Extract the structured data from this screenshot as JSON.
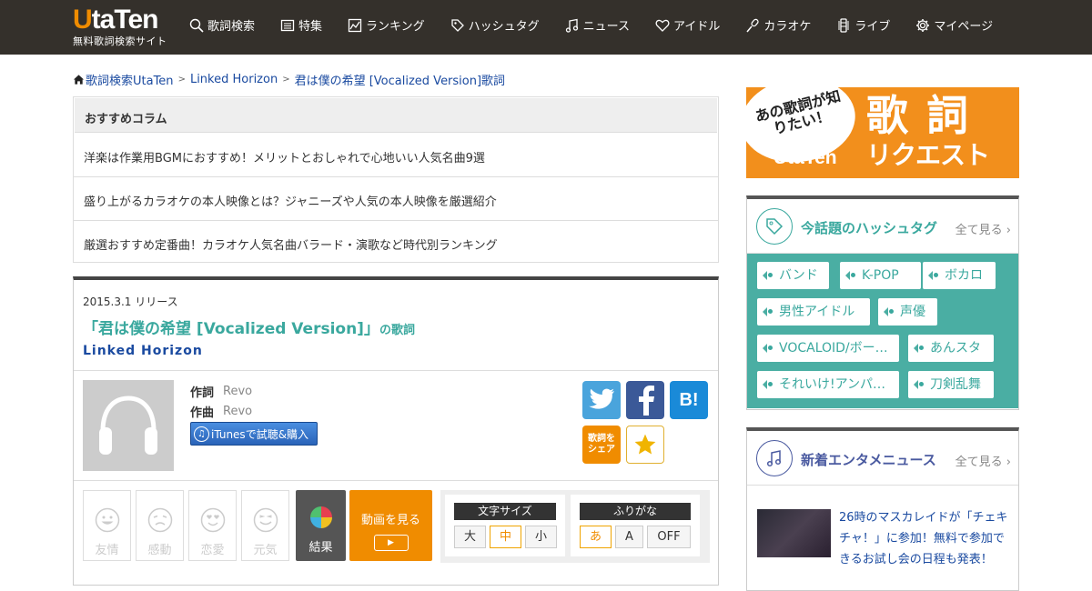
{
  "header": {
    "logo_main": "UtaTen",
    "logo_sub": "無料歌詞検索サイト",
    "nav": [
      {
        "label": "歌詞検索",
        "icon": "search-icon"
      },
      {
        "label": "特集",
        "icon": "feature-icon"
      },
      {
        "label": "ランキング",
        "icon": "ranking-icon"
      },
      {
        "label": "ハッシュタグ",
        "icon": "tag-icon"
      },
      {
        "label": "ニュース",
        "icon": "music-note-icon"
      },
      {
        "label": "アイドル",
        "icon": "heart-icon"
      },
      {
        "label": "カラオケ",
        "icon": "microphone-icon"
      },
      {
        "label": "ライブ",
        "icon": "live-icon"
      },
      {
        "label": "マイページ",
        "icon": "gear-icon"
      }
    ]
  },
  "breadcrumb": {
    "items": [
      "歌詞検索UtaTen",
      "Linked Horizon",
      "君は僕の希望 [Vocalized Version]歌詞"
    ],
    "separator": ">"
  },
  "columns": {
    "heading": "おすすめコラム",
    "items": [
      "洋楽は作業用BGMにおすすめ！メリットとおしゃれで心地いい人気名曲9選",
      "盛り上がるカラオケの本人映像とは？ジャニーズや人気の本人映像を厳選紹介",
      "厳選おすすめ定番曲！カラオケ人気名曲バラード・演歌など時代別ランキング"
    ]
  },
  "song": {
    "release": "2015.3.1 リリース",
    "title": "「君は僕の希望 [Vocalized Version]」",
    "title_suffix": "の歌詞",
    "artist": "Linked Horizon",
    "lyricist_label": "作詞",
    "lyricist": "Revo",
    "composer_label": "作曲",
    "composer": "Revo",
    "itunes_label": "iTunesで試聴&購入",
    "share_label": "歌詞をシェア",
    "emotions": [
      "友情",
      "感動",
      "恋愛",
      "元気"
    ],
    "result_label": "結果",
    "video_label": "動画を見る",
    "font_size": {
      "title": "文字サイズ",
      "options": [
        "大",
        "中",
        "小"
      ],
      "selected": "中"
    },
    "furigana": {
      "title": "ふりがな",
      "options": [
        "あ",
        "A",
        "OFF"
      ],
      "selected": "あ"
    }
  },
  "banner": {
    "bubble_text": "あの歌詞が知りたい！",
    "logo": "UtaTen",
    "big": "歌詞",
    "sub": "リクエスト"
  },
  "hashtags": {
    "title": "今話題のハッシュタグ",
    "more": "全て見る",
    "tags": [
      "バンド",
      "K-POP",
      "ボカロ",
      "男性アイドル",
      "声優",
      "VOCALOID/ボー…",
      "あんスタ",
      "それいけ!アンパ…",
      "刀剣乱舞"
    ]
  },
  "news": {
    "title": "新着エンタメニュース",
    "more": "全て見る",
    "items": [
      {
        "text": "26時のマスカレイドが「チェキチャ！」に参加！無料で参加できるお試し会の日程も発表！"
      }
    ]
  },
  "colors": {
    "header_bg": "#34302b",
    "brand_orange": "#f08c00",
    "teal": "#3aa89e",
    "link_blue": "#1a4aa0",
    "tag_area": "#4aaea3",
    "news_title": "#4a5aa0"
  }
}
